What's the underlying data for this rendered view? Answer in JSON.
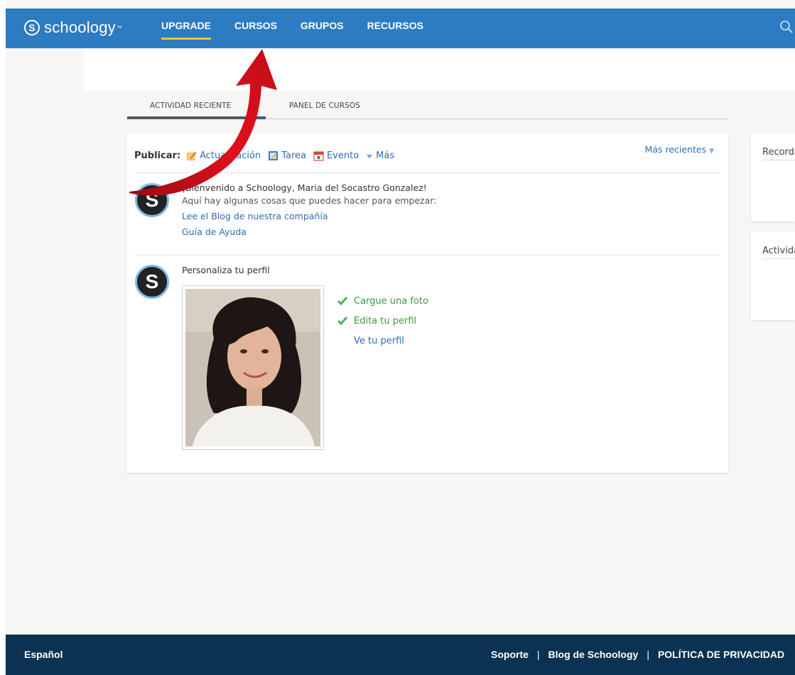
{
  "header": {
    "logo_text": "schoology",
    "logo_mark": "S",
    "nav": [
      {
        "label": "UPGRADE"
      },
      {
        "label": "CURSOS"
      },
      {
        "label": "GRUPOS"
      },
      {
        "label": "RECURSOS"
      }
    ],
    "search_icon": "search-icon"
  },
  "tabs": [
    {
      "label": "ACTIVIDAD RECIENTE",
      "active": true
    },
    {
      "label": "PANEL DE CURSOS",
      "active": false
    }
  ],
  "feed": {
    "publish_label": "Publicar:",
    "publish_items": [
      {
        "label": "Actualización",
        "icon": "pencil-note-icon"
      },
      {
        "label": "Tarea",
        "icon": "assignment-icon"
      },
      {
        "label": "Evento",
        "icon": "calendar-icon"
      },
      {
        "label": "Más",
        "icon": "caret-down-icon"
      }
    ],
    "sort_label": "Más recientes",
    "welcome": {
      "title": "¡Bienvenido a Schoology, Maria del Socastro Gonzalez!",
      "subtitle": "Aquí hay algunas cosas que puedes hacer para empezar:",
      "links": [
        "Lee el Blog de nuestra compañía",
        "Guía de Ayuda"
      ]
    },
    "profile": {
      "title": "Personaliza tu perfil",
      "checklist": [
        {
          "label": "Cargue una foto",
          "done": true
        },
        {
          "label": "Edita tu perfil",
          "done": true
        },
        {
          "label": "Ve tu perfil",
          "done": false
        }
      ]
    }
  },
  "sidebar": {
    "cards": [
      {
        "title": "Recordatorios"
      },
      {
        "title": "Actividad"
      }
    ]
  },
  "footer": {
    "language": "Español",
    "links": [
      "Soporte",
      "Blog de Schoology",
      "POLÍTICA DE PRIVACIDAD"
    ]
  },
  "colors": {
    "header_bg": "#2d7bc1",
    "nav_active_underline": "#f5c518",
    "link": "#2f6db3",
    "check_green": "#3d9a3a",
    "footer_bg": "#0b3252",
    "annotation_arrow": "#d0021b"
  }
}
